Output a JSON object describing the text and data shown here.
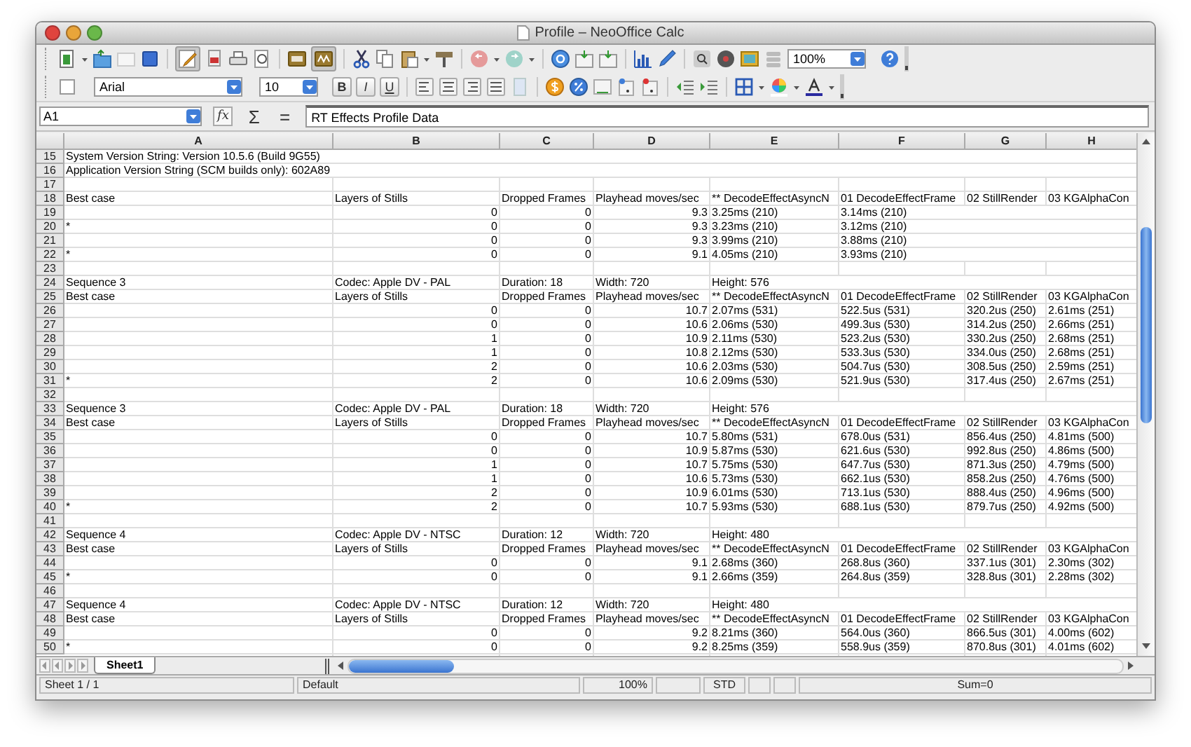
{
  "window": {
    "title": "Profile – NeoOffice Calc"
  },
  "standard_toolbar": {
    "edit_file_on": true,
    "auto_spellcheck_on": true,
    "zoom": "100%"
  },
  "formatting_toolbar": {
    "font": "Arial",
    "size": "10",
    "style_buttons": [
      "B",
      "I",
      "U"
    ]
  },
  "formula_bar": {
    "cell_reference": "A1",
    "symbols": [
      "fx",
      "Σ",
      "="
    ],
    "formula": "RT Effects Profile Data"
  },
  "columns": [
    "A",
    "B",
    "C",
    "D",
    "E",
    "F",
    "G",
    "H"
  ],
  "rows": [
    {
      "number": "15",
      "texts": {
        "A": "System Version String: Version 10.5.6 (Build 9G55)"
      }
    },
    {
      "number": "16",
      "texts": {
        "A": "Application Version String (SCM builds only): 602A89"
      }
    },
    {
      "number": "17"
    },
    {
      "number": "18",
      "texts": {
        "A": "Best case",
        "B": "Layers of Stills",
        "C": "Dropped Frames",
        "D": "Playhead moves/sec",
        "E": "** DecodeEffectAsyncN",
        "F": "01 DecodeEffectFrame",
        "G": "02 StillRender",
        "H": "03 KGAlphaCon"
      }
    },
    {
      "number": "19",
      "numbers": {
        "B": "0",
        "C": "0",
        "D": "9.3"
      },
      "texts": {
        "E": "3.25ms (210)",
        "F": "3.14ms (210)"
      }
    },
    {
      "number": "20",
      "numbers": {
        "B": "0",
        "C": "0",
        "D": "9.3"
      },
      "texts": {
        "A": "*",
        "E": "3.23ms (210)",
        "F": "3.12ms (210)"
      }
    },
    {
      "number": "21",
      "numbers": {
        "B": "0",
        "C": "0",
        "D": "9.3"
      },
      "texts": {
        "E": "3.99ms (210)",
        "F": "3.88ms (210)"
      }
    },
    {
      "number": "22",
      "numbers": {
        "B": "0",
        "C": "0",
        "D": "9.1"
      },
      "texts": {
        "A": "*",
        "E": "4.05ms (210)",
        "F": "3.93ms (210)"
      }
    },
    {
      "number": "23"
    },
    {
      "number": "24",
      "texts": {
        "A": "Sequence 3",
        "B": "Codec: Apple DV - PAL",
        "C": "Duration: 18",
        "D": "Width: 720",
        "E": "Height: 576"
      }
    },
    {
      "number": "25",
      "texts": {
        "A": "Best case",
        "B": "Layers of Stills",
        "C": "Dropped Frames",
        "D": "Playhead moves/sec",
        "E": "** DecodeEffectAsyncN",
        "F": "01 DecodeEffectFrame",
        "G": "02 StillRender",
        "H": "03 KGAlphaCon"
      }
    },
    {
      "number": "26",
      "numbers": {
        "B": "0",
        "C": "0",
        "D": "10.7"
      },
      "texts": {
        "E": "2.07ms (531)",
        "F": "522.5us (531)",
        "G": "320.2us (250)",
        "H": "2.61ms (251)"
      }
    },
    {
      "number": "27",
      "numbers": {
        "B": "0",
        "C": "0",
        "D": "10.6"
      },
      "texts": {
        "E": "2.06ms (530)",
        "F": "499.3us (530)",
        "G": "314.2us (250)",
        "H": "2.66ms (251)"
      }
    },
    {
      "number": "28",
      "numbers": {
        "B": "1",
        "C": "0",
        "D": "10.9"
      },
      "texts": {
        "E": "2.11ms (530)",
        "F": "523.2us (530)",
        "G": "330.2us (250)",
        "H": "2.68ms (251)"
      }
    },
    {
      "number": "29",
      "numbers": {
        "B": "1",
        "C": "0",
        "D": "10.8"
      },
      "texts": {
        "E": "2.12ms (530)",
        "F": "533.3us (530)",
        "G": "334.0us (250)",
        "H": "2.68ms (251)"
      }
    },
    {
      "number": "30",
      "numbers": {
        "B": "2",
        "C": "0",
        "D": "10.6"
      },
      "texts": {
        "E": "2.03ms (530)",
        "F": "504.7us (530)",
        "G": "308.5us (250)",
        "H": "2.59ms (251)"
      }
    },
    {
      "number": "31",
      "numbers": {
        "B": "2",
        "C": "0",
        "D": "10.6"
      },
      "texts": {
        "A": "*",
        "E": "2.09ms (530)",
        "F": "521.9us (530)",
        "G": "317.4us (250)",
        "H": "2.67ms (251)"
      }
    },
    {
      "number": "32"
    },
    {
      "number": "33",
      "texts": {
        "A": "Sequence 3",
        "B": "Codec: Apple DV - PAL",
        "C": "Duration: 18",
        "D": "Width: 720",
        "E": "Height: 576"
      }
    },
    {
      "number": "34",
      "texts": {
        "A": "Best case",
        "B": "Layers of Stills",
        "C": "Dropped Frames",
        "D": "Playhead moves/sec",
        "E": "** DecodeEffectAsyncN",
        "F": "01 DecodeEffectFrame",
        "G": "02 StillRender",
        "H": "03 KGAlphaCon"
      }
    },
    {
      "number": "35",
      "numbers": {
        "B": "0",
        "C": "0",
        "D": "10.7"
      },
      "texts": {
        "E": "5.80ms (531)",
        "F": "678.0us (531)",
        "G": "856.4us (250)",
        "H": "4.81ms (500)"
      }
    },
    {
      "number": "36",
      "numbers": {
        "B": "0",
        "C": "0",
        "D": "10.9"
      },
      "texts": {
        "E": "5.87ms (530)",
        "F": "621.6us (530)",
        "G": "992.8us (250)",
        "H": "4.86ms (500)"
      }
    },
    {
      "number": "37",
      "numbers": {
        "B": "1",
        "C": "0",
        "D": "10.7"
      },
      "texts": {
        "E": "5.75ms (530)",
        "F": "647.7us (530)",
        "G": "871.3us (250)",
        "H": "4.79ms (500)"
      }
    },
    {
      "number": "38",
      "numbers": {
        "B": "1",
        "C": "0",
        "D": "10.6"
      },
      "texts": {
        "E": "5.73ms (530)",
        "F": "662.1us (530)",
        "G": "858.2us (250)",
        "H": "4.76ms (500)"
      }
    },
    {
      "number": "39",
      "numbers": {
        "B": "2",
        "C": "0",
        "D": "10.9"
      },
      "texts": {
        "E": "6.01ms (530)",
        "F": "713.1us (530)",
        "G": "888.4us (250)",
        "H": "4.96ms (500)"
      }
    },
    {
      "number": "40",
      "numbers": {
        "B": "2",
        "C": "0",
        "D": "10.7"
      },
      "texts": {
        "A": "*",
        "E": "5.93ms (530)",
        "F": "688.1us (530)",
        "G": "879.7us (250)",
        "H": "4.92ms (500)"
      }
    },
    {
      "number": "41"
    },
    {
      "number": "42",
      "texts": {
        "A": "Sequence 4",
        "B": "Codec: Apple DV - NTSC",
        "C": "Duration: 12",
        "D": "Width: 720",
        "E": "Height: 480"
      }
    },
    {
      "number": "43",
      "texts": {
        "A": "Best case",
        "B": "Layers of Stills",
        "C": "Dropped Frames",
        "D": "Playhead moves/sec",
        "E": "** DecodeEffectAsyncN",
        "F": "01 DecodeEffectFrame",
        "G": "02 StillRender",
        "H": "03 KGAlphaCon"
      }
    },
    {
      "number": "44",
      "numbers": {
        "B": "0",
        "C": "0",
        "D": "9.1"
      },
      "texts": {
        "E": "2.68ms (360)",
        "F": "268.8us (360)",
        "G": "337.1us (301)",
        "H": "2.30ms (302)"
      }
    },
    {
      "number": "45",
      "numbers": {
        "B": "0",
        "C": "0",
        "D": "9.1"
      },
      "texts": {
        "A": "*",
        "E": "2.66ms (359)",
        "F": "264.8us (359)",
        "G": "328.8us (301)",
        "H": "2.28ms (302)"
      }
    },
    {
      "number": "46"
    },
    {
      "number": "47",
      "texts": {
        "A": "Sequence 4",
        "B": "Codec: Apple DV - NTSC",
        "C": "Duration: 12",
        "D": "Width: 720",
        "E": "Height: 480"
      }
    },
    {
      "number": "48",
      "texts": {
        "A": "Best case",
        "B": "Layers of Stills",
        "C": "Dropped Frames",
        "D": "Playhead moves/sec",
        "E": "** DecodeEffectAsyncN",
        "F": "01 DecodeEffectFrame",
        "G": "02 StillRender",
        "H": "03 KGAlphaCon"
      }
    },
    {
      "number": "49",
      "numbers": {
        "B": "0",
        "C": "0",
        "D": "9.2"
      },
      "texts": {
        "E": "8.21ms (360)",
        "F": "564.0us (360)",
        "G": "866.5us (301)",
        "H": "4.00ms (602)"
      }
    },
    {
      "number": "50",
      "numbers": {
        "B": "0",
        "C": "0",
        "D": "9.2"
      },
      "texts": {
        "A": "*",
        "E": "8.25ms (359)",
        "F": "558.9us (359)",
        "G": "870.8us (301)",
        "H": "4.01ms (602)"
      }
    }
  ],
  "sheet_tabs": [
    {
      "label": "Sheet1",
      "selected": true
    }
  ],
  "status_bar": {
    "sheet": "Sheet 1 / 1",
    "page_style": "Default",
    "zoom": "100%",
    "mode": "STD",
    "sum": "Sum=0"
  }
}
